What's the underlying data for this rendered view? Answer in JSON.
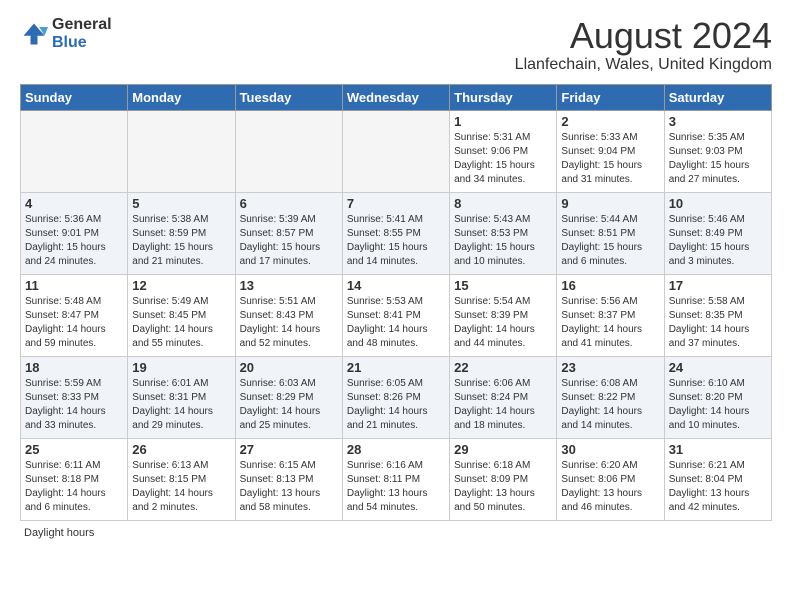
{
  "logo": {
    "general": "General",
    "blue": "Blue"
  },
  "title": "August 2024",
  "subtitle": "Llanfechain, Wales, United Kingdom",
  "days_of_week": [
    "Sunday",
    "Monday",
    "Tuesday",
    "Wednesday",
    "Thursday",
    "Friday",
    "Saturday"
  ],
  "footer": "Daylight hours",
  "weeks": [
    [
      {
        "day": "",
        "info": ""
      },
      {
        "day": "",
        "info": ""
      },
      {
        "day": "",
        "info": ""
      },
      {
        "day": "",
        "info": ""
      },
      {
        "day": "1",
        "info": "Sunrise: 5:31 AM\nSunset: 9:06 PM\nDaylight: 15 hours\nand 34 minutes."
      },
      {
        "day": "2",
        "info": "Sunrise: 5:33 AM\nSunset: 9:04 PM\nDaylight: 15 hours\nand 31 minutes."
      },
      {
        "day": "3",
        "info": "Sunrise: 5:35 AM\nSunset: 9:03 PM\nDaylight: 15 hours\nand 27 minutes."
      }
    ],
    [
      {
        "day": "4",
        "info": "Sunrise: 5:36 AM\nSunset: 9:01 PM\nDaylight: 15 hours\nand 24 minutes."
      },
      {
        "day": "5",
        "info": "Sunrise: 5:38 AM\nSunset: 8:59 PM\nDaylight: 15 hours\nand 21 minutes."
      },
      {
        "day": "6",
        "info": "Sunrise: 5:39 AM\nSunset: 8:57 PM\nDaylight: 15 hours\nand 17 minutes."
      },
      {
        "day": "7",
        "info": "Sunrise: 5:41 AM\nSunset: 8:55 PM\nDaylight: 15 hours\nand 14 minutes."
      },
      {
        "day": "8",
        "info": "Sunrise: 5:43 AM\nSunset: 8:53 PM\nDaylight: 15 hours\nand 10 minutes."
      },
      {
        "day": "9",
        "info": "Sunrise: 5:44 AM\nSunset: 8:51 PM\nDaylight: 15 hours\nand 6 minutes."
      },
      {
        "day": "10",
        "info": "Sunrise: 5:46 AM\nSunset: 8:49 PM\nDaylight: 15 hours\nand 3 minutes."
      }
    ],
    [
      {
        "day": "11",
        "info": "Sunrise: 5:48 AM\nSunset: 8:47 PM\nDaylight: 14 hours\nand 59 minutes."
      },
      {
        "day": "12",
        "info": "Sunrise: 5:49 AM\nSunset: 8:45 PM\nDaylight: 14 hours\nand 55 minutes."
      },
      {
        "day": "13",
        "info": "Sunrise: 5:51 AM\nSunset: 8:43 PM\nDaylight: 14 hours\nand 52 minutes."
      },
      {
        "day": "14",
        "info": "Sunrise: 5:53 AM\nSunset: 8:41 PM\nDaylight: 14 hours\nand 48 minutes."
      },
      {
        "day": "15",
        "info": "Sunrise: 5:54 AM\nSunset: 8:39 PM\nDaylight: 14 hours\nand 44 minutes."
      },
      {
        "day": "16",
        "info": "Sunrise: 5:56 AM\nSunset: 8:37 PM\nDaylight: 14 hours\nand 41 minutes."
      },
      {
        "day": "17",
        "info": "Sunrise: 5:58 AM\nSunset: 8:35 PM\nDaylight: 14 hours\nand 37 minutes."
      }
    ],
    [
      {
        "day": "18",
        "info": "Sunrise: 5:59 AM\nSunset: 8:33 PM\nDaylight: 14 hours\nand 33 minutes."
      },
      {
        "day": "19",
        "info": "Sunrise: 6:01 AM\nSunset: 8:31 PM\nDaylight: 14 hours\nand 29 minutes."
      },
      {
        "day": "20",
        "info": "Sunrise: 6:03 AM\nSunset: 8:29 PM\nDaylight: 14 hours\nand 25 minutes."
      },
      {
        "day": "21",
        "info": "Sunrise: 6:05 AM\nSunset: 8:26 PM\nDaylight: 14 hours\nand 21 minutes."
      },
      {
        "day": "22",
        "info": "Sunrise: 6:06 AM\nSunset: 8:24 PM\nDaylight: 14 hours\nand 18 minutes."
      },
      {
        "day": "23",
        "info": "Sunrise: 6:08 AM\nSunset: 8:22 PM\nDaylight: 14 hours\nand 14 minutes."
      },
      {
        "day": "24",
        "info": "Sunrise: 6:10 AM\nSunset: 8:20 PM\nDaylight: 14 hours\nand 10 minutes."
      }
    ],
    [
      {
        "day": "25",
        "info": "Sunrise: 6:11 AM\nSunset: 8:18 PM\nDaylight: 14 hours\nand 6 minutes."
      },
      {
        "day": "26",
        "info": "Sunrise: 6:13 AM\nSunset: 8:15 PM\nDaylight: 14 hours\nand 2 minutes."
      },
      {
        "day": "27",
        "info": "Sunrise: 6:15 AM\nSunset: 8:13 PM\nDaylight: 13 hours\nand 58 minutes."
      },
      {
        "day": "28",
        "info": "Sunrise: 6:16 AM\nSunset: 8:11 PM\nDaylight: 13 hours\nand 54 minutes."
      },
      {
        "day": "29",
        "info": "Sunrise: 6:18 AM\nSunset: 8:09 PM\nDaylight: 13 hours\nand 50 minutes."
      },
      {
        "day": "30",
        "info": "Sunrise: 6:20 AM\nSunset: 8:06 PM\nDaylight: 13 hours\nand 46 minutes."
      },
      {
        "day": "31",
        "info": "Sunrise: 6:21 AM\nSunset: 8:04 PM\nDaylight: 13 hours\nand 42 minutes."
      }
    ]
  ]
}
